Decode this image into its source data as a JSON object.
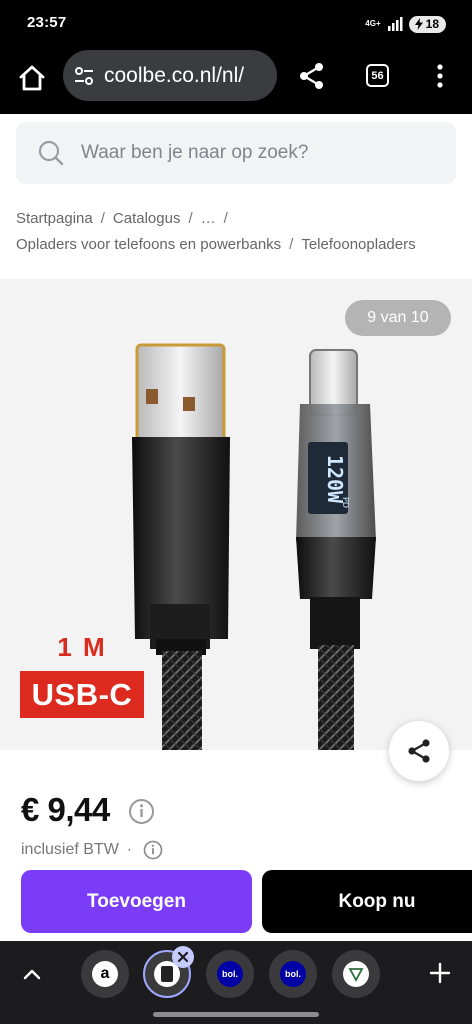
{
  "status": {
    "time": "23:57",
    "network": "4G+",
    "battery": "18"
  },
  "browser": {
    "url": "coolbe.co.nl/nl/",
    "tab_count": "56"
  },
  "search": {
    "placeholder": "Waar ben je naar op zoek?"
  },
  "breadcrumb": {
    "items": [
      "Startpagina",
      "Catalogus",
      "…",
      "Opladers voor telefoons en powerbanks",
      "Telefoonopladers"
    ],
    "separator": "/"
  },
  "gallery": {
    "counter": "9 van 10",
    "image_text": {
      "length": "1 M",
      "type": "USB-C",
      "display": "120W",
      "pd": "PD"
    }
  },
  "product": {
    "price": "€ 9,44",
    "vat_label": "inclusief BTW",
    "vat_dot": "·"
  },
  "actions": {
    "add_label": "Toevoegen",
    "buy_label": "Koop nu"
  },
  "bottom_tabs": {
    "items": [
      {
        "icon": "amazon-favicon-icon",
        "text": "a"
      },
      {
        "icon": "current-tab-favicon-icon",
        "text": ""
      },
      {
        "icon": "bol-favicon-icon",
        "text": "bol."
      },
      {
        "icon": "bol-favicon-icon",
        "text": "bol."
      },
      {
        "icon": "shop-favicon-icon",
        "text": ""
      }
    ]
  },
  "colors": {
    "accent": "#7b3cf8",
    "badge_red": "#dc2a1e",
    "bar_dark": "#000000"
  }
}
